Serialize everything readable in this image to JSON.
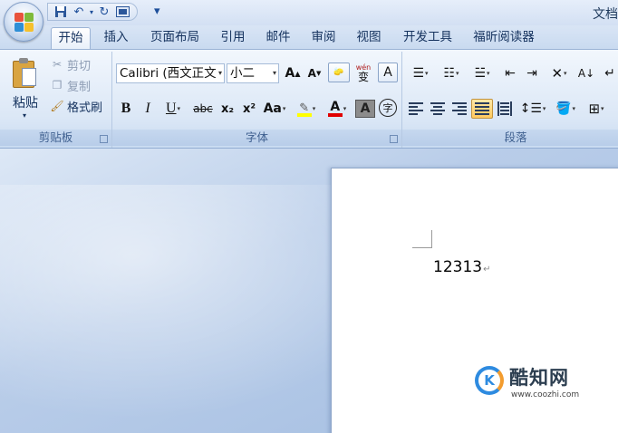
{
  "window": {
    "title": "文档"
  },
  "qat": {
    "save": "save-icon",
    "undo": "undo-icon",
    "redo": "redo-icon",
    "print_preview": "print-preview-icon",
    "more": "▾"
  },
  "tabs": [
    {
      "label": "开始"
    },
    {
      "label": "插入"
    },
    {
      "label": "页面布局"
    },
    {
      "label": "引用"
    },
    {
      "label": "邮件"
    },
    {
      "label": "审阅"
    },
    {
      "label": "视图"
    },
    {
      "label": "开发工具"
    },
    {
      "label": "福昕阅读器"
    }
  ],
  "clipboard": {
    "group_label": "剪贴板",
    "paste_label": "粘贴",
    "cut_label": "剪切",
    "copy_label": "复制",
    "format_painter_label": "格式刷"
  },
  "font": {
    "group_label": "字体",
    "font_name": "Calibri (西文正文",
    "font_size": "小二",
    "bold": "B",
    "italic": "I",
    "underline": "U",
    "strike": "abc",
    "subscript": "x₂",
    "superscript": "x²",
    "change_case": "Aa",
    "grow": "A",
    "shrink": "A",
    "phonetic": "wén",
    "phonetic_char": "变",
    "char_border": "A",
    "char_shading": "A",
    "enclose": "字"
  },
  "paragraph": {
    "group_label": "段落"
  },
  "document": {
    "text": "12313",
    "para_mark": "↵"
  },
  "watermark": {
    "title": "酷知网",
    "url": "www.coozhi.com",
    "logo_letter": "K"
  },
  "colors": {
    "highlight": "#ffff00",
    "font_color": "#e00000",
    "accent": "#2b579a"
  }
}
